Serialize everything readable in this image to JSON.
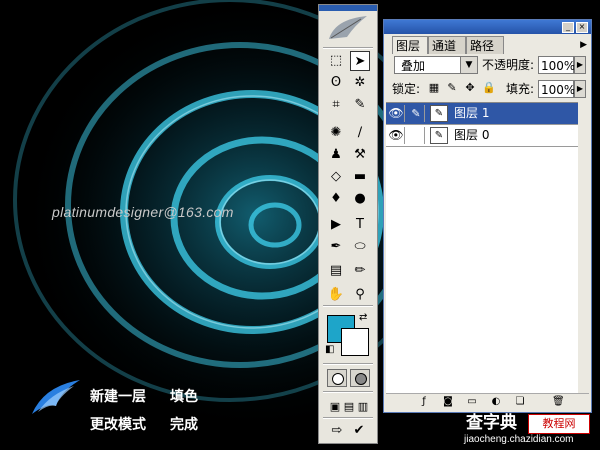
{
  "canvas": {
    "email": "platinumdesigner@163.com",
    "captions": [
      [
        "新建一层",
        "填色"
      ],
      [
        "更改模式",
        "完成"
      ]
    ],
    "accent_color": "#1ea5c9"
  },
  "toolbox": {
    "foreground_color": "#1ea5c9",
    "background_color": "#ffffff",
    "tools": [
      {
        "name": "marquee-tool",
        "glyph": "⬚"
      },
      {
        "name": "move-tool",
        "glyph": "➤",
        "selected": true
      },
      {
        "name": "lasso-tool",
        "glyph": "ʘ"
      },
      {
        "name": "magic-wand-tool",
        "glyph": "✲"
      },
      {
        "name": "crop-tool",
        "glyph": "⌗"
      },
      {
        "name": "slice-tool",
        "glyph": "✎"
      },
      {
        "name": "healing-brush-tool",
        "glyph": "✺"
      },
      {
        "name": "brush-tool",
        "glyph": "∕"
      },
      {
        "name": "clone-stamp-tool",
        "glyph": "♟"
      },
      {
        "name": "history-brush-tool",
        "glyph": "⚒"
      },
      {
        "name": "eraser-tool",
        "glyph": "◇"
      },
      {
        "name": "gradient-tool",
        "glyph": "▬"
      },
      {
        "name": "blur-tool",
        "glyph": "♦"
      },
      {
        "name": "dodge-tool",
        "glyph": "●"
      },
      {
        "name": "path-selection-tool",
        "glyph": "▶"
      },
      {
        "name": "type-tool",
        "glyph": "T"
      },
      {
        "name": "pen-tool",
        "glyph": "✒"
      },
      {
        "name": "shape-tool",
        "glyph": "⬭"
      },
      {
        "name": "notes-tool",
        "glyph": "▤"
      },
      {
        "name": "eyedropper-tool",
        "glyph": "✏"
      },
      {
        "name": "hand-tool",
        "glyph": "✋"
      },
      {
        "name": "zoom-tool",
        "glyph": "⚲"
      }
    ]
  },
  "layers_panel": {
    "tabs": [
      "图层",
      "通道",
      "路径"
    ],
    "active_tab": "图层",
    "blend_mode": "叠加",
    "opacity_label": "不透明度:",
    "opacity_value": "100%",
    "lock_label": "锁定:",
    "fill_label": "填充:",
    "fill_value": "100%",
    "layers": [
      {
        "name": "图层 1",
        "selected": true,
        "visible": true
      },
      {
        "name": "图层 0",
        "selected": false,
        "visible": true
      }
    ],
    "bottom_icons": [
      "layer-style-icon",
      "mask-icon",
      "folder-icon",
      "adjustment-layer-icon",
      "new-layer-icon",
      "trash-icon"
    ]
  },
  "watermark": {
    "title": "查字典",
    "tag": "教程网",
    "url": "jiaocheng.chazidian.com"
  }
}
